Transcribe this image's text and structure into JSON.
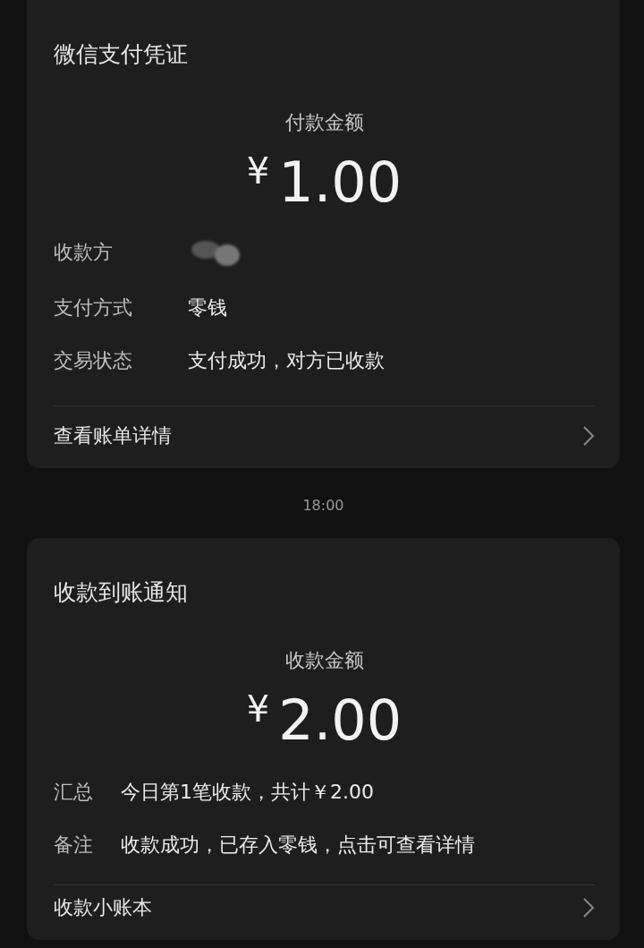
{
  "messages": [
    {
      "kind": "receipt",
      "title": "微信支付凭证",
      "amount_label": "付款金额",
      "currency": "¥",
      "amount": "1.00",
      "fields": [
        {
          "kind": "redacted",
          "label": "收款方"
        },
        {
          "kind": "text",
          "label": "支付方式",
          "value": "零钱"
        },
        {
          "kind": "text",
          "label": "交易状态",
          "value": "支付成功，对方已收款"
        }
      ],
      "link": "查看账单详情"
    },
    {
      "kind": "time",
      "text": "18:00"
    },
    {
      "kind": "notice",
      "title": "收款到账通知",
      "amount_label": "收款金额",
      "currency": "¥",
      "amount": "2.00",
      "fields": [
        {
          "kind": "text",
          "label": "汇总",
          "value": "今日第1笔收款，共计￥2.00"
        },
        {
          "kind": "text",
          "label": "备注",
          "value": "收款成功，已存入零钱，点击可查看详情"
        }
      ],
      "link": "收款小账本"
    }
  ]
}
